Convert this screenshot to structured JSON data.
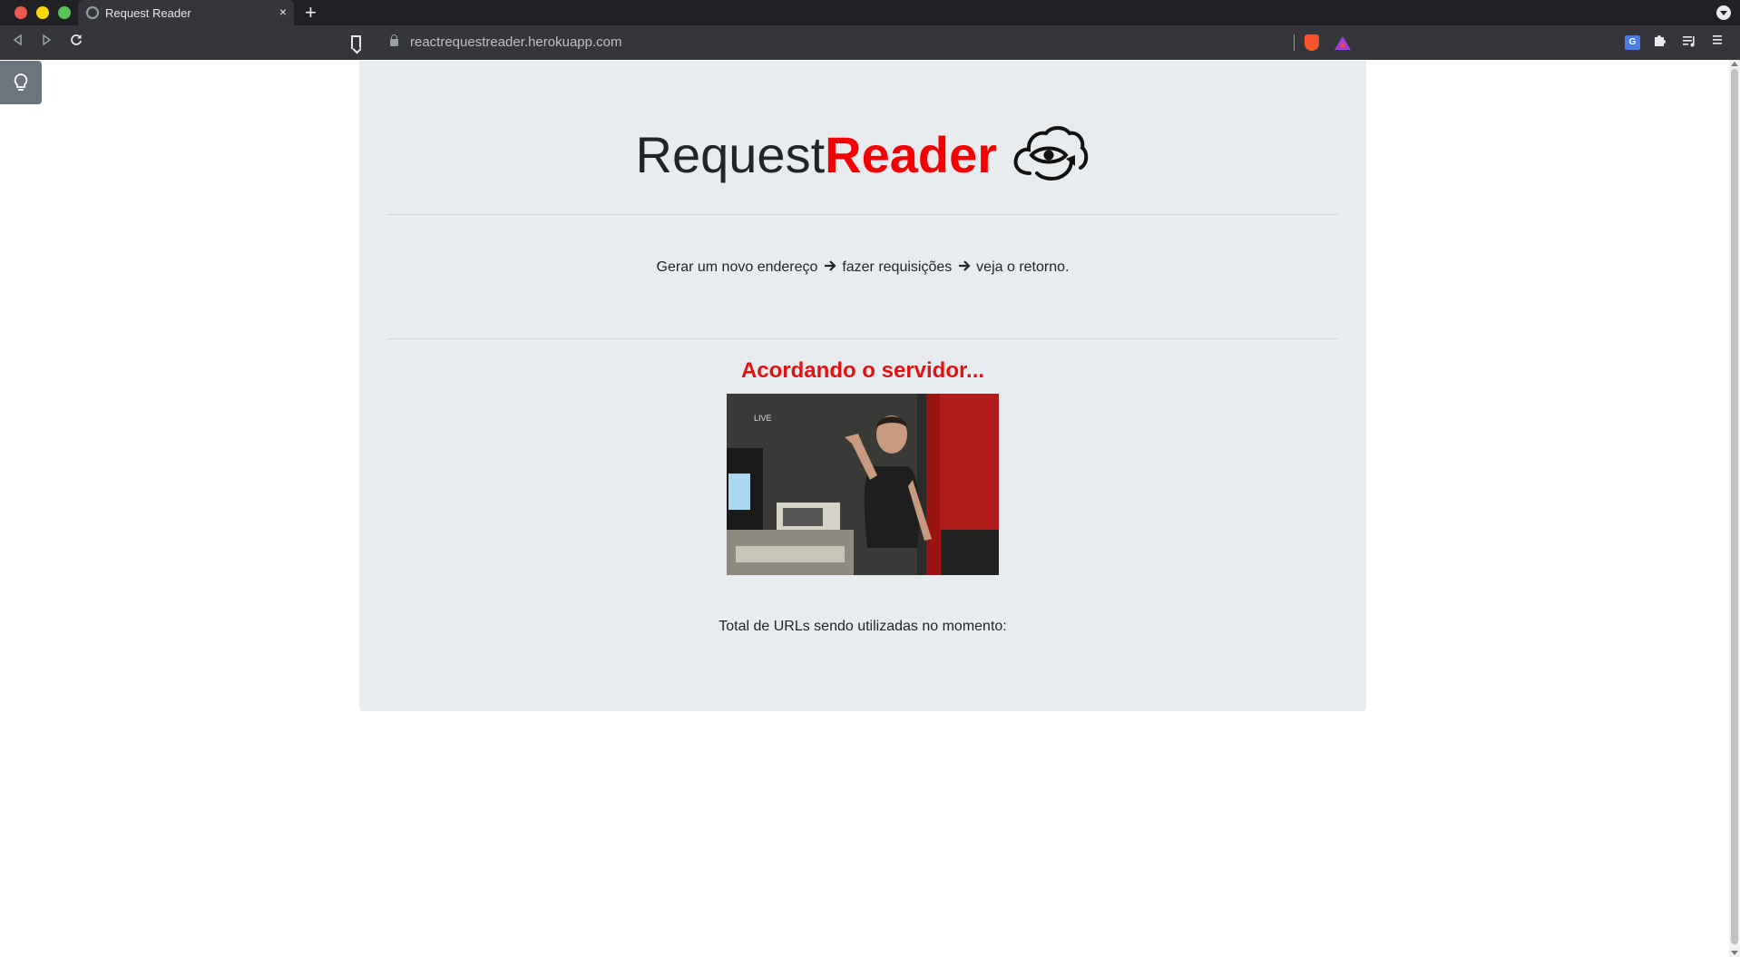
{
  "browser": {
    "tab_title": "Request Reader",
    "tab_close": "×",
    "new_tab": "+",
    "url": "reactrequestreader.herokuapp.com",
    "icons": {
      "back": "back-icon",
      "forward": "forward-icon",
      "reload": "reload-icon",
      "bookmark": "bookmark-icon",
      "lock": "lock-icon",
      "brave": "brave-shields-icon",
      "rewards": "brave-rewards-icon",
      "translate": "translate-icon",
      "extensions": "puzzle-icon",
      "media": "media-queue-icon",
      "menu": "hamburger-menu-icon"
    }
  },
  "page": {
    "title_part1": "Request ",
    "title_part2": "Reader",
    "steps": {
      "step1": "Gerar um novo endereço",
      "step2": "fazer requisições",
      "step3": "veja o retorno."
    },
    "status": "Acordando o servidor...",
    "gif_text": "LIVE",
    "total_label": "Total de URLs sendo utilizadas no momento:"
  },
  "colors": {
    "accent_red": "#f50000",
    "jumbotron_bg": "#e9ecef",
    "tip_button_bg": "#6c757d"
  }
}
